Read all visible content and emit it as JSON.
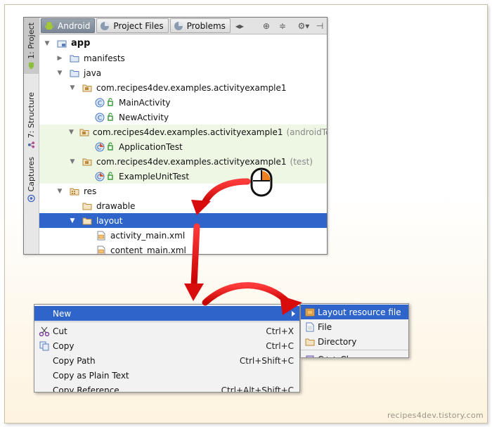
{
  "ide": {
    "side_tabs": [
      {
        "label": "1: Project",
        "icon": "android-icon"
      },
      {
        "label": "7: Structure",
        "icon": "structure-icon"
      },
      {
        "label": "Captures",
        "icon": "captures-icon"
      }
    ],
    "tabs": [
      {
        "label": "Android",
        "icon": "android-icon"
      },
      {
        "label": "Project Files",
        "icon": "project-files-icon"
      },
      {
        "label": "Problems",
        "icon": "problems-icon"
      }
    ],
    "toolbar_icons": [
      "split-arrows-icon",
      "target-icon",
      "collapse-icon",
      "gear-icon",
      "pin-icon"
    ]
  },
  "tree": {
    "app": "app",
    "manifests": "manifests",
    "java": "java",
    "pkg_main": "com.recipes4dev.examples.activityexample1",
    "main_activity": "MainActivity",
    "new_activity": "NewActivity",
    "pkg_android_test": "com.recipes4dev.examples.activityexample1",
    "android_test_suffix": "(androidTest)",
    "application_test": "ApplicationTest",
    "pkg_test": "com.recipes4dev.examples.activityexample1",
    "test_suffix": "(test)",
    "example_unit_test": "ExampleUnitTest",
    "res": "res",
    "drawable": "drawable",
    "layout": "layout",
    "activity_main": "activity_main.xml",
    "content_main": "content_main.xml"
  },
  "context_menu": {
    "new": "New",
    "cut": "Cut",
    "cut_shortcut": "Ctrl+X",
    "copy": "Copy",
    "copy_shortcut": "Ctrl+C",
    "copy_path": "Copy Path",
    "copy_path_shortcut": "Ctrl+Shift+C",
    "copy_plain": "Copy as Plain Text",
    "copy_reference": "Copy Reference",
    "copy_reference_shortcut": "Ctrl+Alt+Shift+C"
  },
  "submenu": {
    "layout_resource_file": "Layout resource file",
    "file": "File",
    "directory": "Directory",
    "cpp_class": "C++ Class"
  },
  "colors": {
    "selection": "#2f65ca",
    "arrow_red": "#e41a1a",
    "test_row_bg": "#eef6e4"
  },
  "watermark": "recipes4dev.tistory.com"
}
